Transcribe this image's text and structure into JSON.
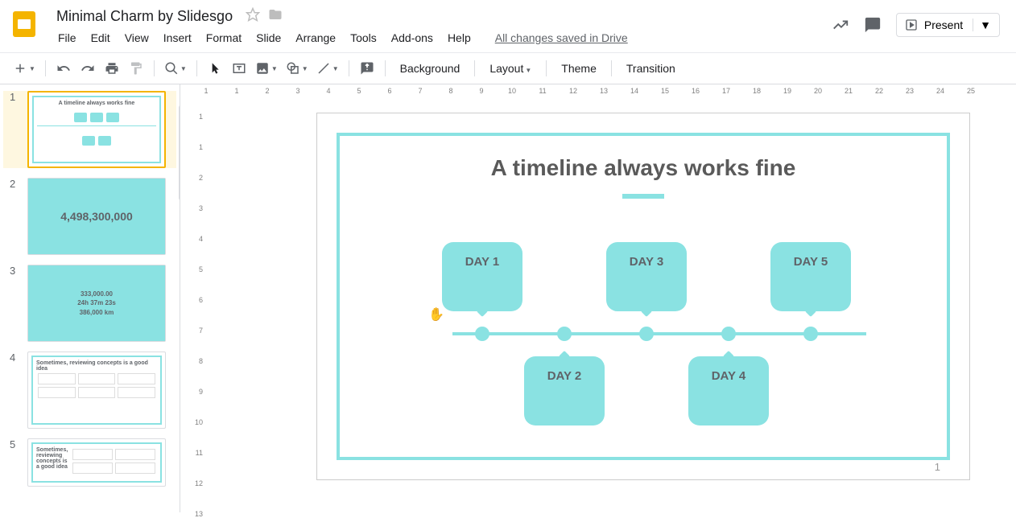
{
  "doc": {
    "title": "Minimal Charm by Slidesgo",
    "saved_status": "All changes saved in Drive"
  },
  "menus": [
    "File",
    "Edit",
    "View",
    "Insert",
    "Format",
    "Slide",
    "Arrange",
    "Tools",
    "Add-ons",
    "Help"
  ],
  "header_actions": {
    "present": "Present"
  },
  "toolbar": {
    "background": "Background",
    "layout": "Layout",
    "theme": "Theme",
    "transition": "Transition"
  },
  "ruler_h": [
    "1",
    "1",
    "2",
    "3",
    "4",
    "5",
    "6",
    "7",
    "8",
    "9",
    "10",
    "11",
    "12",
    "13",
    "14",
    "15",
    "16",
    "17",
    "18",
    "19",
    "20",
    "21",
    "22",
    "23",
    "24",
    "25"
  ],
  "ruler_v": [
    "1",
    "1",
    "2",
    "3",
    "4",
    "5",
    "6",
    "7",
    "8",
    "9",
    "10",
    "11",
    "12",
    "13"
  ],
  "thumbs": [
    {
      "num": "1",
      "title": "A timeline always works fine"
    },
    {
      "num": "2",
      "big": "4,498,300,000"
    },
    {
      "num": "3",
      "lines": [
        "333,000.00",
        "24h 37m 23s",
        "386,000 km"
      ]
    },
    {
      "num": "4",
      "heading": "Sometimes, reviewing concepts is a good idea"
    },
    {
      "num": "5",
      "heading": "Sometimes, reviewing concepts is a good idea"
    }
  ],
  "slide": {
    "title": "A timeline always works fine",
    "days": [
      "DAY 1",
      "DAY 2",
      "DAY 3",
      "DAY 4",
      "DAY 5"
    ],
    "page_number": "1"
  }
}
